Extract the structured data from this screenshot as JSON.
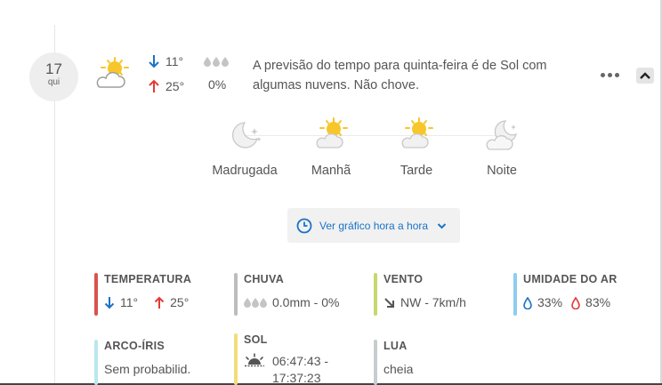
{
  "day": {
    "date": "17",
    "weekday": "qui"
  },
  "summary": {
    "weather_icon": "sun-behind-cloud-icon",
    "temp_min": "11°",
    "temp_max": "25°",
    "rain_probability": "0%",
    "forecast_text": "A previsão do tempo para quinta-feira é de Sol com algumas nuvens. Não chove."
  },
  "periods": [
    {
      "label": "Madrugada",
      "icon": "moon-stars-icon"
    },
    {
      "label": "Manhã",
      "icon": "sun-behind-cloud-icon"
    },
    {
      "label": "Tarde",
      "icon": "sun-behind-cloud-icon"
    },
    {
      "label": "Noite",
      "icon": "moon-behind-cloud-icon"
    }
  ],
  "hourly_button": {
    "label": "Ver gráfico hora a hora",
    "icon": "clock-icon"
  },
  "stats": {
    "temperature": {
      "title": "TEMPERATURA",
      "min": "11°",
      "max": "25°",
      "color": "#d9534f"
    },
    "rain": {
      "title": "CHUVA",
      "value": "0.0mm - 0%",
      "color": "#bdbdbd"
    },
    "wind": {
      "title": "VENTO",
      "value": "NW - 7km/h",
      "color": "#c5d86d"
    },
    "humidity": {
      "title": "UMIDADE DO AR",
      "min": "33%",
      "max": "83%",
      "color": "#8ecdf0"
    },
    "rainbow": {
      "title": "ARCO-ÍRIS",
      "value": "Sem probabilid.",
      "color": "#b9e8ee"
    },
    "sun": {
      "title": "SOL",
      "value": "06:47:43 - 17:37:23",
      "color": "#f5dc7a"
    },
    "moon": {
      "title": "LUA",
      "value": "cheia",
      "color": "#c8ccce"
    }
  },
  "colors": {
    "accent_blue": "#1a73c8",
    "arrow_red": "#e53935",
    "sun_yellow": "#f7c62a"
  }
}
